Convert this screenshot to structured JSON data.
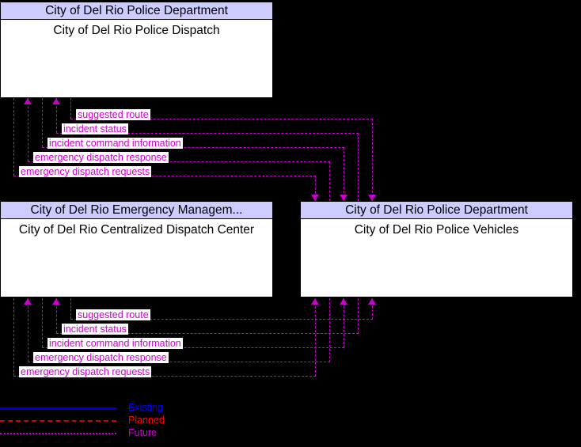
{
  "diagram": {
    "title": "City of Del Rio Police Dispatch interface context diagram",
    "background_color": "#000000",
    "flow_color": "#cc00cc",
    "box_header_color": "#ccccff",
    "box_body_color": "#ffffff"
  },
  "boxes": [
    {
      "id": "police-dispatch",
      "stakeholder": "City of Del Rio Police Department",
      "element": "City of Del Rio Police Dispatch"
    },
    {
      "id": "centralized-dispatch",
      "stakeholder": "City of Del Rio Emergency Managem...",
      "element": "City of Del Rio Centralized Dispatch Center"
    },
    {
      "id": "police-vehicles",
      "stakeholder": "City of Del Rio Police Department",
      "element": "City of Del Rio Police Vehicles"
    }
  ],
  "flows_top": [
    {
      "label": "suggested route"
    },
    {
      "label": "incident status"
    },
    {
      "label": "incident command information"
    },
    {
      "label": "emergency dispatch response"
    },
    {
      "label": "emergency dispatch requests"
    }
  ],
  "flows_bottom": [
    {
      "label": "suggested route"
    },
    {
      "label": "incident status"
    },
    {
      "label": "incident command information"
    },
    {
      "label": "emergency dispatch response"
    },
    {
      "label": "emergency dispatch requests"
    }
  ],
  "legend": {
    "items": [
      {
        "label": "Existing",
        "style": "solid",
        "color": "#0000ff"
      },
      {
        "label": "Planned",
        "style": "dash-dot",
        "color": "#ff0000"
      },
      {
        "label": "Future",
        "style": "dotted",
        "color": "#cc00cc"
      }
    ]
  }
}
